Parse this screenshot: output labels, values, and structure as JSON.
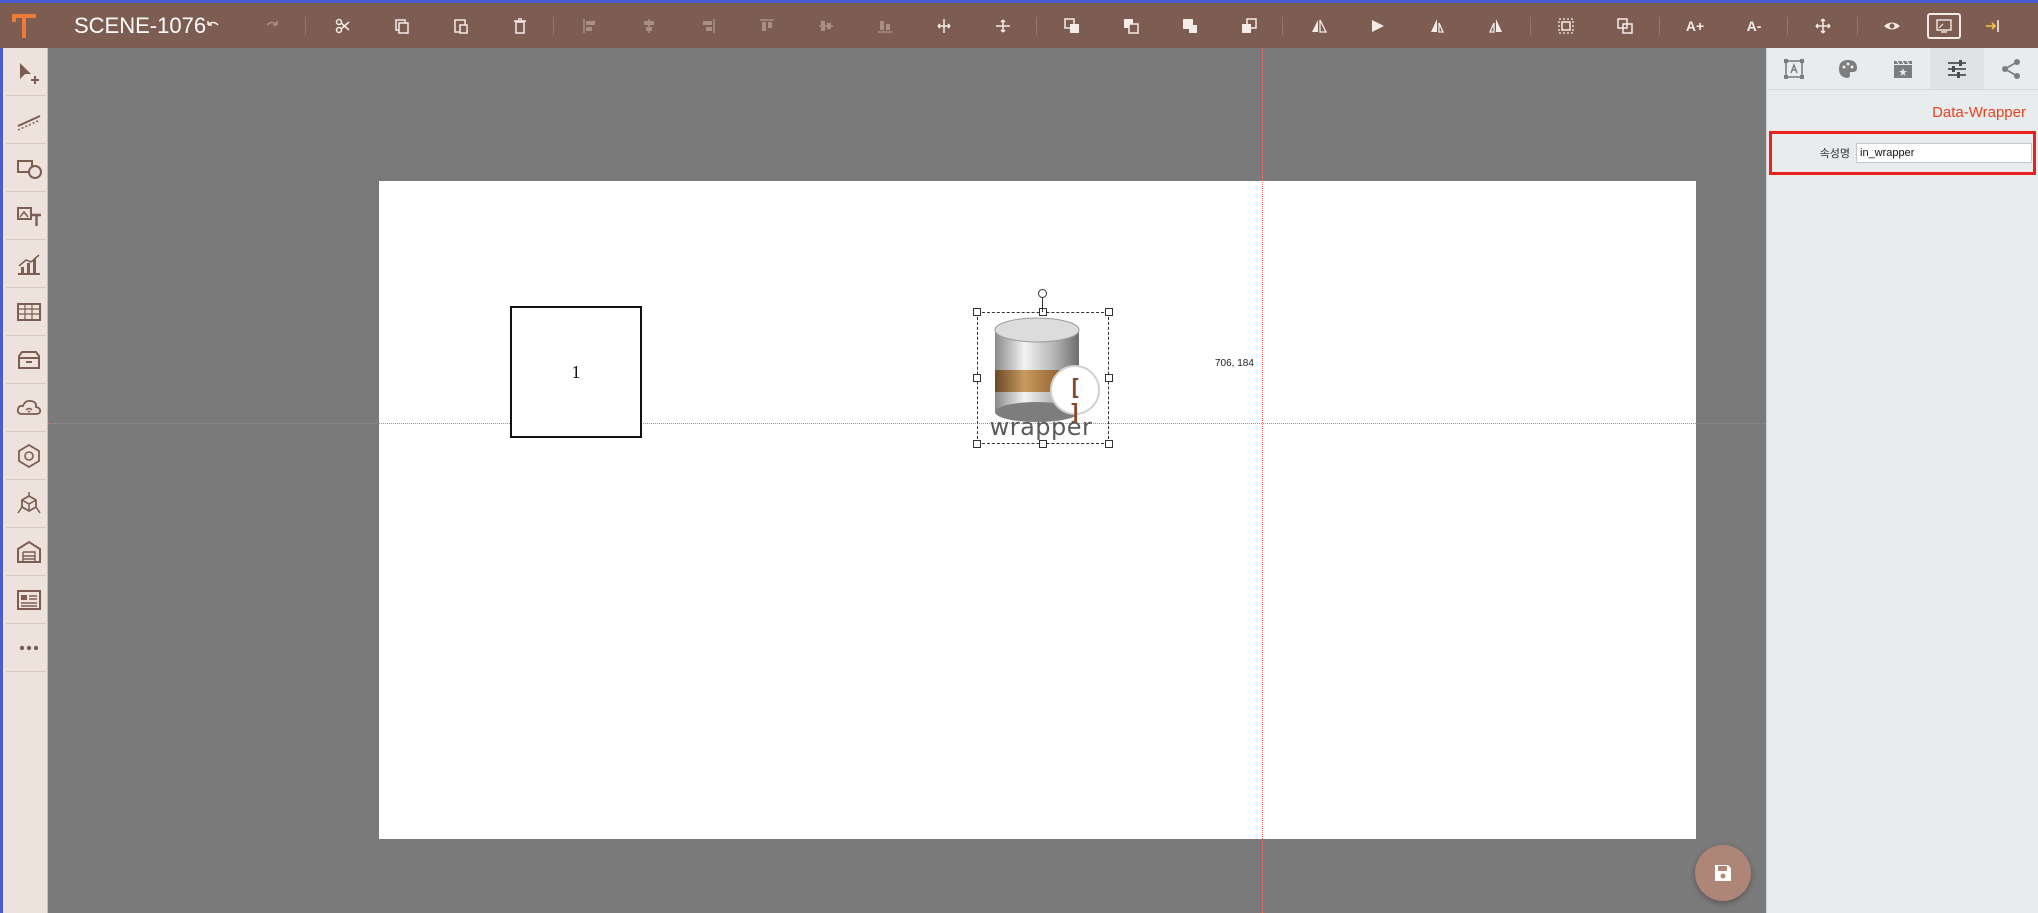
{
  "app": {
    "scene_title": "SCENE-1076"
  },
  "toolbar": {
    "buttons": [
      {
        "name": "undo",
        "enabled": true
      },
      {
        "name": "redo",
        "enabled": false
      },
      {
        "name": "cut",
        "enabled": true
      },
      {
        "name": "copy",
        "enabled": true
      },
      {
        "name": "paste",
        "enabled": true
      },
      {
        "name": "delete",
        "enabled": true
      },
      {
        "name": "align-left",
        "enabled": false
      },
      {
        "name": "align-center",
        "enabled": false
      },
      {
        "name": "align-right",
        "enabled": false
      },
      {
        "name": "align-top",
        "enabled": false
      },
      {
        "name": "align-middle",
        "enabled": false
      },
      {
        "name": "align-bottom",
        "enabled": false
      },
      {
        "name": "distribute-horizontal",
        "enabled": true
      },
      {
        "name": "distribute-vertical",
        "enabled": true
      },
      {
        "name": "bring-to-front",
        "enabled": true
      },
      {
        "name": "bring-forward",
        "enabled": true
      },
      {
        "name": "send-backward",
        "enabled": true
      },
      {
        "name": "send-to-back",
        "enabled": true
      },
      {
        "name": "flip-horizontal",
        "enabled": true
      },
      {
        "name": "flip-vertical",
        "enabled": true
      },
      {
        "name": "rotate-cw",
        "enabled": true
      },
      {
        "name": "rotate-ccw",
        "enabled": true
      },
      {
        "name": "group",
        "enabled": true
      },
      {
        "name": "ungroup",
        "enabled": true
      },
      {
        "name": "font-increase",
        "enabled": true
      },
      {
        "name": "font-decrease",
        "enabled": true
      },
      {
        "name": "fit",
        "enabled": true
      },
      {
        "name": "preview",
        "enabled": true
      },
      {
        "name": "fullscreen",
        "enabled": true
      },
      {
        "name": "exit",
        "enabled": true
      }
    ],
    "font_increase_label": "A+",
    "font_decrease_label": "A-"
  },
  "leftbar": {
    "items": [
      "pointer-tool-icon",
      "line-tool-icon",
      "shape-tool-icon",
      "image-text-tool-icon",
      "chart-tool-icon",
      "table-tool-icon",
      "storage-tool-icon",
      "cloud-tool-icon",
      "gauge-tool-icon",
      "3d-tool-icon",
      "warehouse-tool-icon",
      "form-tool-icon",
      "more-tools-icon"
    ]
  },
  "canvas": {
    "rect_label": "1",
    "wrapper_label": "wrapper",
    "wrapper_badge": "[ ]",
    "coord_readout": "706, 184"
  },
  "right_panel": {
    "tabs": [
      {
        "name": "shape-tab",
        "icon": "shape-icon",
        "active": false
      },
      {
        "name": "style-tab",
        "icon": "palette-icon",
        "active": false
      },
      {
        "name": "effect-tab",
        "icon": "film-icon",
        "active": false
      },
      {
        "name": "properties-tab",
        "icon": "sliders-icon",
        "active": true
      },
      {
        "name": "data-tab",
        "icon": "share-icon",
        "active": false
      }
    ],
    "heading": "Data-Wrapper",
    "field_label": "속성명",
    "field_value": "in_wrapper"
  },
  "colors": {
    "toolbar_bg": "#7d5c52",
    "accent_red": "#e8411b",
    "canvas_bg": "#7a7a7a",
    "fab": "#ad8677"
  }
}
